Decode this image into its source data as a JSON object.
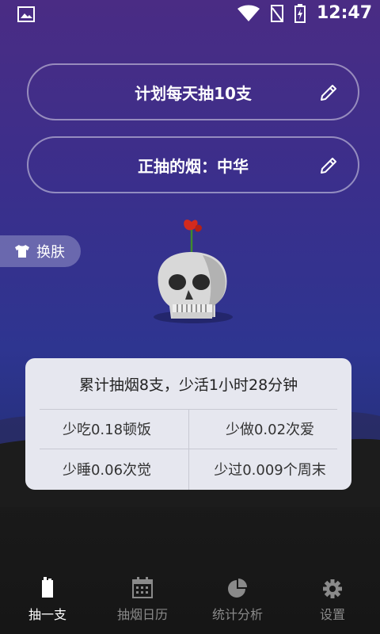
{
  "status_bar": {
    "time": "12:47",
    "icons": [
      "image-icon",
      "wifi-icon",
      "no-signal-icon",
      "battery-charging-icon"
    ]
  },
  "plan": {
    "label": "计划每天抽10支",
    "edit_icon": "pencil-icon"
  },
  "brand": {
    "label": "正抽的烟：中华",
    "edit_icon": "pencil-icon"
  },
  "skin_button": {
    "label": "换肤",
    "icon": "shirt-icon"
  },
  "stats": {
    "summary": "累计抽烟8支，少活1小时28分钟",
    "cells": [
      "少吃0.18顿饭",
      "少做0.02次爱",
      "少睡0.06次觉",
      "少过0.009个周末"
    ]
  },
  "nav": {
    "items": [
      {
        "label": "抽一支",
        "icon": "cigarette-icon",
        "active": true
      },
      {
        "label": "抽烟日历",
        "icon": "calendar-icon",
        "active": false
      },
      {
        "label": "统计分析",
        "icon": "pie-chart-icon",
        "active": false
      },
      {
        "label": "设置",
        "icon": "gear-icon",
        "active": false
      }
    ]
  },
  "colors": {
    "bg_top": "#4a2c84",
    "bg_mid": "#2e3590",
    "bg_bottom": "#161616",
    "card_bg": "#e6e7ef",
    "nav_active": "#ffffff",
    "nav_inactive": "#8a8a8a"
  }
}
